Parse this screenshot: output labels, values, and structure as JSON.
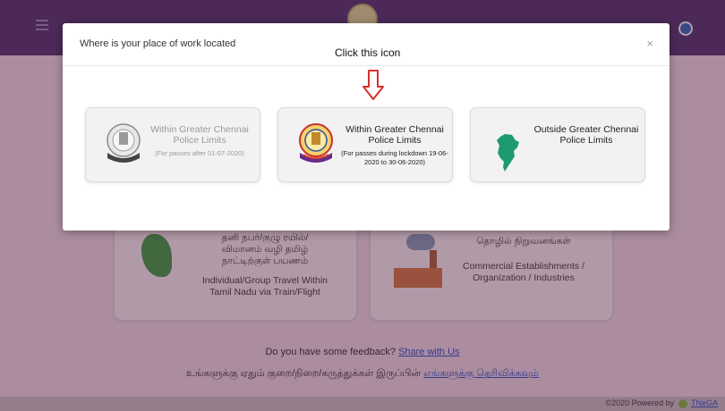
{
  "modal": {
    "title": "Where is your place of work located",
    "close": "×",
    "annotation": "Click this icon",
    "options": [
      {
        "title": "Within Greater Chennai Police Limits",
        "sub": "(For passes after 01-07-2020)"
      },
      {
        "title": "Within Greater Chennai Police Limits",
        "sub": "(For passes during lockdown 19-06-2020 to 30-06-2020)"
      },
      {
        "title": "Outside Greater Chennai Police Limits",
        "sub": ""
      }
    ]
  },
  "background": {
    "card1": {
      "tamil": "தனி நபர்/குழு ரயில்/ விமானம் வழி தமிழ் நாட்டிற்குள் பயணம்",
      "english": "Individual/Group Travel Within Tamil Nadu via Train/Flight"
    },
    "card2": {
      "tamil": "தொழில் நிறுவனங்கள்",
      "english": "Commercial Establishments / Organization / Industries"
    },
    "feedback_text": "Do you have some feedback?",
    "feedback_link": "Share with Us",
    "tamil_feedback_text": "உங்களுக்கு ஏதும் குறை/நிறை/கருத்துக்கள் இருப்பின்",
    "tamil_feedback_link": "எங்களுக்கு தெரிவிக்கவும்"
  },
  "footer": {
    "text": "©2020 Powered by",
    "link": "TNeGA"
  },
  "colors": {
    "topbar": "#4a2a63",
    "arrow": "#d9302c",
    "link": "#2a44b8"
  }
}
